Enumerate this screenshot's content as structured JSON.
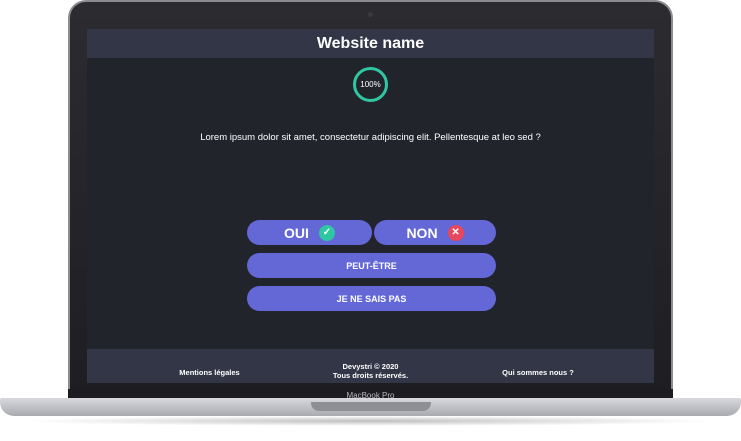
{
  "site": {
    "title": "Website name"
  },
  "progress": {
    "label": "100%",
    "value": 100
  },
  "question": {
    "text": "Lorem ipsum dolor sit amet, consectetur adipiscing elit. Pellentesque at leo sed ?"
  },
  "answers": {
    "yes": {
      "label": "OUI",
      "icon": "check-icon"
    },
    "no": {
      "label": "NON",
      "icon": "cross-icon"
    },
    "maybe": {
      "label": "PEUT-ÊTRE"
    },
    "unknown": {
      "label": "JE NE SAIS PAS"
    }
  },
  "footer": {
    "legal": "Mentions légales",
    "copyright_line1": "Devystri © 2020",
    "copyright_line2": "Tous droits réservés.",
    "about": "Qui sommes nous ?"
  },
  "device": {
    "label": "MacBook Pro"
  },
  "colors": {
    "accent": "#6368d6",
    "success": "#2fc7a1",
    "danger": "#e8465a",
    "background": "#22242c",
    "header": "#333647"
  }
}
